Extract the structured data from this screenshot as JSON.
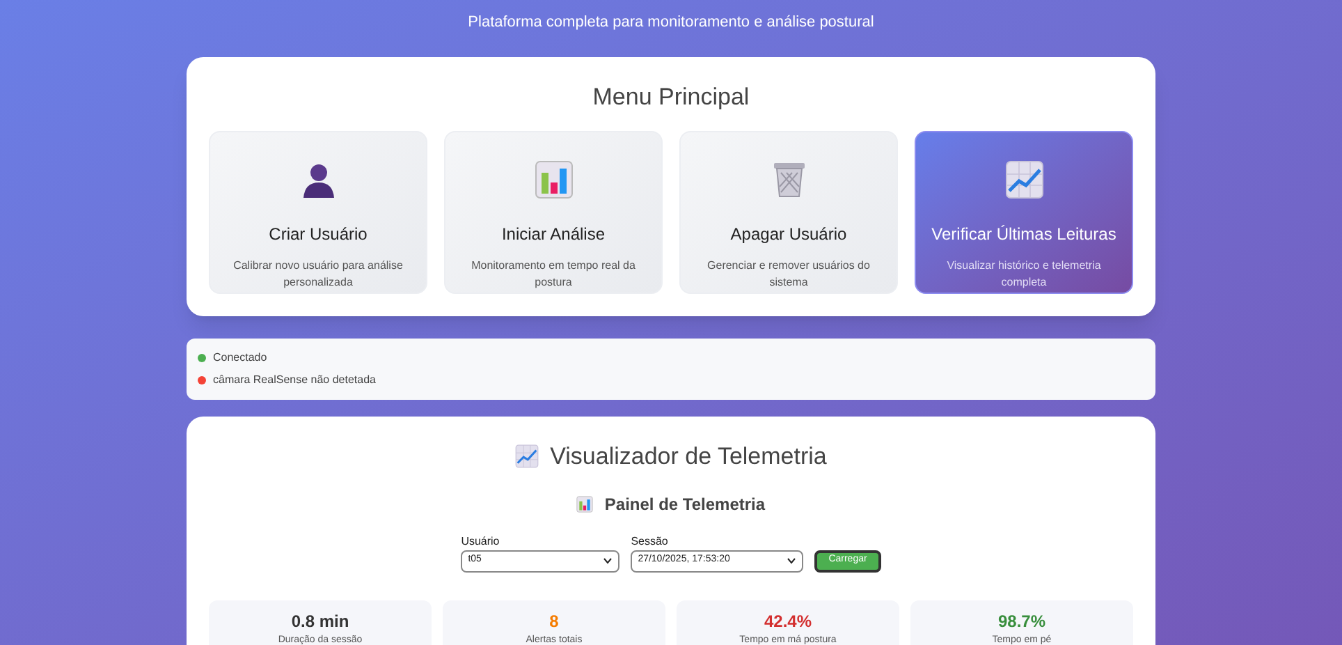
{
  "subtitle": "Plataforma completa para monitoramento e análise postural",
  "menu": {
    "title": "Menu Principal",
    "items": [
      {
        "kind": "person",
        "title": "Criar Usuário",
        "description": "Calibrar novo usuário para análise personalizada",
        "selected": false
      },
      {
        "kind": "bars",
        "title": "Iniciar Análise",
        "description": "Monitoramento em tempo real da postura",
        "selected": false
      },
      {
        "kind": "trash",
        "title": "Apagar Usuário",
        "description": "Gerenciar e remover usuários do sistema",
        "selected": false
      },
      {
        "kind": "trend",
        "title": "Verificar Últimas Leituras",
        "description": "Visualizar histórico e telemetria completa",
        "selected": true
      }
    ]
  },
  "status": [
    {
      "label": "Conectado",
      "color": "#4caf50"
    },
    {
      "label": "câmara RealSense não detetada",
      "color": "#f44336"
    }
  ],
  "telemetry": {
    "title": "Visualizador de Telemetria",
    "panel_title": "Painel de Telemetria",
    "user_field": {
      "label": "Usuário",
      "value": "t05"
    },
    "session_field": {
      "label": "Sessão",
      "value": "27/10/2025, 17:53:20"
    },
    "load_button": "Carregar",
    "stats": [
      {
        "value": "0.8 min",
        "label": "Duração da sessão",
        "color": "#333333"
      },
      {
        "value": "8",
        "label": "Alertas totais",
        "color": "#f57c00"
      },
      {
        "value": "42.4%",
        "label": "Tempo em má postura",
        "color": "#d32f2f"
      },
      {
        "value": "98.7%",
        "label": "Tempo em pé",
        "color": "#388e3c"
      }
    ]
  }
}
